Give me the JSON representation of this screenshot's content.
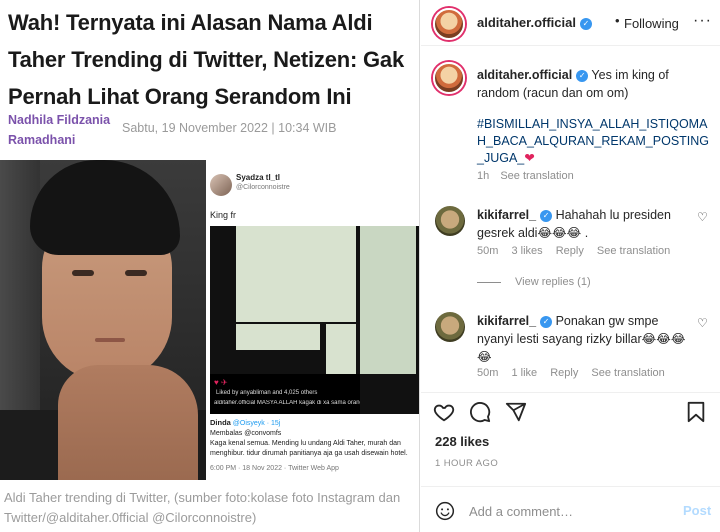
{
  "article": {
    "headline": "Wah! Ternyata ini Alasan Nama Aldi Taher Trending di Twitter, Netizen: Gak Pernah Lihat Orang Serandom Ini",
    "author": "Nadhila Fildzania Ramadhani",
    "date": "Sabtu, 19 November 2022 | 10:34 WIB",
    "caption": "Aldi Taher trending di Twitter, (sumber foto:kolase foto Instagram dan Twitter/@alditaher.0fficial @Cilorconnoistre)"
  },
  "tweet": {
    "name": "Syadza tl_tl",
    "handle": "@Cilorconnoistre",
    "text": "King fr",
    "ig_liked_by": "Liked by anyabliman and 4,025 others",
    "ig_caption": "alditaher.official MASYA ALLAH kagak di xa sama orangtuaku sikirim di...",
    "reply_name": "Dinda",
    "reply_handle": "@Oisyeyk · 15j",
    "reply_to": "Membalas @convomfs",
    "reply_text": "Kaga kenal semua. Mending lu undang Aldi Taher, murah dan menghibur. tidur dirumah panitianya aja ga usah disewain hotel.",
    "footer": "6:00 PM · 18 Nov 2022 · Twitter Web App"
  },
  "instagram": {
    "username": "alditaher.official",
    "dot": "•",
    "following": "Following",
    "more": "···",
    "caption_text": "Yes im king of random (racun dan om om)",
    "hashtags": "#BISMILLAH_INSYA_ALLAH_ISTIQOMAH_BACA_ALQURAN_REKAM_POSTING_JUGA_",
    "heart_emoji": "❤",
    "caption_time": "1h",
    "see_translation": "See translation",
    "comments": [
      {
        "username": "kikifarrel_",
        "text": "Hahahah lu presiden gesrek aldi😂😂😂 .",
        "time": "50m",
        "likes": "3 likes",
        "reply": "Reply",
        "translate": "See translation"
      },
      {
        "username": "kikifarrel_",
        "text": "Ponakan gw smpe nyanyi lesti sayang rizky billar😂😂😂😂",
        "time": "50m",
        "likes": "1 like",
        "reply": "Reply",
        "translate": "See translation"
      }
    ],
    "view_replies": "View replies (1)",
    "likes_count": "228 likes",
    "time_ago": "1 HOUR AGO",
    "comment_placeholder": "Add a comment…",
    "post_label": "Post",
    "colors": {
      "link": "#00376b",
      "verified": "#3897f0",
      "post": "#b3dbff",
      "author": "#7b52ab"
    }
  }
}
